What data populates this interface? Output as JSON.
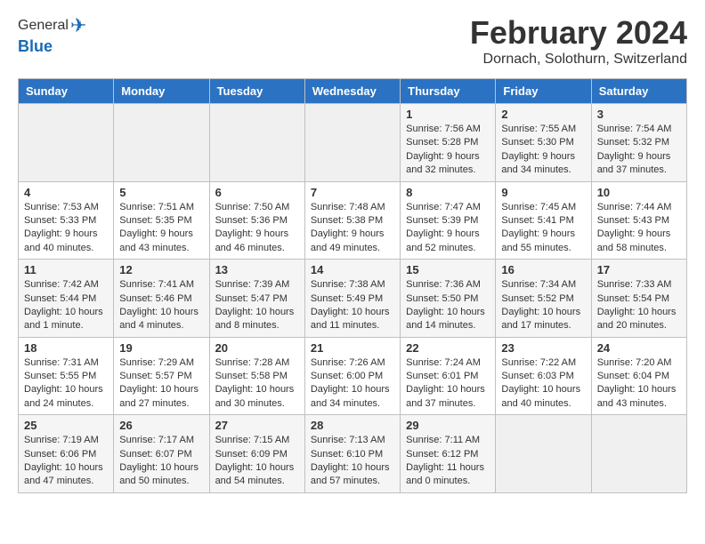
{
  "header": {
    "logo_line1": "General",
    "logo_line2": "Blue",
    "title": "February 2024",
    "subtitle": "Dornach, Solothurn, Switzerland"
  },
  "calendar": {
    "days_of_week": [
      "Sunday",
      "Monday",
      "Tuesday",
      "Wednesday",
      "Thursday",
      "Friday",
      "Saturday"
    ],
    "weeks": [
      [
        {
          "day": "",
          "info": ""
        },
        {
          "day": "",
          "info": ""
        },
        {
          "day": "",
          "info": ""
        },
        {
          "day": "",
          "info": ""
        },
        {
          "day": "1",
          "info": "Sunrise: 7:56 AM\nSunset: 5:28 PM\nDaylight: 9 hours\nand 32 minutes."
        },
        {
          "day": "2",
          "info": "Sunrise: 7:55 AM\nSunset: 5:30 PM\nDaylight: 9 hours\nand 34 minutes."
        },
        {
          "day": "3",
          "info": "Sunrise: 7:54 AM\nSunset: 5:32 PM\nDaylight: 9 hours\nand 37 minutes."
        }
      ],
      [
        {
          "day": "4",
          "info": "Sunrise: 7:53 AM\nSunset: 5:33 PM\nDaylight: 9 hours\nand 40 minutes."
        },
        {
          "day": "5",
          "info": "Sunrise: 7:51 AM\nSunset: 5:35 PM\nDaylight: 9 hours\nand 43 minutes."
        },
        {
          "day": "6",
          "info": "Sunrise: 7:50 AM\nSunset: 5:36 PM\nDaylight: 9 hours\nand 46 minutes."
        },
        {
          "day": "7",
          "info": "Sunrise: 7:48 AM\nSunset: 5:38 PM\nDaylight: 9 hours\nand 49 minutes."
        },
        {
          "day": "8",
          "info": "Sunrise: 7:47 AM\nSunset: 5:39 PM\nDaylight: 9 hours\nand 52 minutes."
        },
        {
          "day": "9",
          "info": "Sunrise: 7:45 AM\nSunset: 5:41 PM\nDaylight: 9 hours\nand 55 minutes."
        },
        {
          "day": "10",
          "info": "Sunrise: 7:44 AM\nSunset: 5:43 PM\nDaylight: 9 hours\nand 58 minutes."
        }
      ],
      [
        {
          "day": "11",
          "info": "Sunrise: 7:42 AM\nSunset: 5:44 PM\nDaylight: 10 hours\nand 1 minute."
        },
        {
          "day": "12",
          "info": "Sunrise: 7:41 AM\nSunset: 5:46 PM\nDaylight: 10 hours\nand 4 minutes."
        },
        {
          "day": "13",
          "info": "Sunrise: 7:39 AM\nSunset: 5:47 PM\nDaylight: 10 hours\nand 8 minutes."
        },
        {
          "day": "14",
          "info": "Sunrise: 7:38 AM\nSunset: 5:49 PM\nDaylight: 10 hours\nand 11 minutes."
        },
        {
          "day": "15",
          "info": "Sunrise: 7:36 AM\nSunset: 5:50 PM\nDaylight: 10 hours\nand 14 minutes."
        },
        {
          "day": "16",
          "info": "Sunrise: 7:34 AM\nSunset: 5:52 PM\nDaylight: 10 hours\nand 17 minutes."
        },
        {
          "day": "17",
          "info": "Sunrise: 7:33 AM\nSunset: 5:54 PM\nDaylight: 10 hours\nand 20 minutes."
        }
      ],
      [
        {
          "day": "18",
          "info": "Sunrise: 7:31 AM\nSunset: 5:55 PM\nDaylight: 10 hours\nand 24 minutes."
        },
        {
          "day": "19",
          "info": "Sunrise: 7:29 AM\nSunset: 5:57 PM\nDaylight: 10 hours\nand 27 minutes."
        },
        {
          "day": "20",
          "info": "Sunrise: 7:28 AM\nSunset: 5:58 PM\nDaylight: 10 hours\nand 30 minutes."
        },
        {
          "day": "21",
          "info": "Sunrise: 7:26 AM\nSunset: 6:00 PM\nDaylight: 10 hours\nand 34 minutes."
        },
        {
          "day": "22",
          "info": "Sunrise: 7:24 AM\nSunset: 6:01 PM\nDaylight: 10 hours\nand 37 minutes."
        },
        {
          "day": "23",
          "info": "Sunrise: 7:22 AM\nSunset: 6:03 PM\nDaylight: 10 hours\nand 40 minutes."
        },
        {
          "day": "24",
          "info": "Sunrise: 7:20 AM\nSunset: 6:04 PM\nDaylight: 10 hours\nand 43 minutes."
        }
      ],
      [
        {
          "day": "25",
          "info": "Sunrise: 7:19 AM\nSunset: 6:06 PM\nDaylight: 10 hours\nand 47 minutes."
        },
        {
          "day": "26",
          "info": "Sunrise: 7:17 AM\nSunset: 6:07 PM\nDaylight: 10 hours\nand 50 minutes."
        },
        {
          "day": "27",
          "info": "Sunrise: 7:15 AM\nSunset: 6:09 PM\nDaylight: 10 hours\nand 54 minutes."
        },
        {
          "day": "28",
          "info": "Sunrise: 7:13 AM\nSunset: 6:10 PM\nDaylight: 10 hours\nand 57 minutes."
        },
        {
          "day": "29",
          "info": "Sunrise: 7:11 AM\nSunset: 6:12 PM\nDaylight: 11 hours\nand 0 minutes."
        },
        {
          "day": "",
          "info": ""
        },
        {
          "day": "",
          "info": ""
        }
      ]
    ]
  }
}
